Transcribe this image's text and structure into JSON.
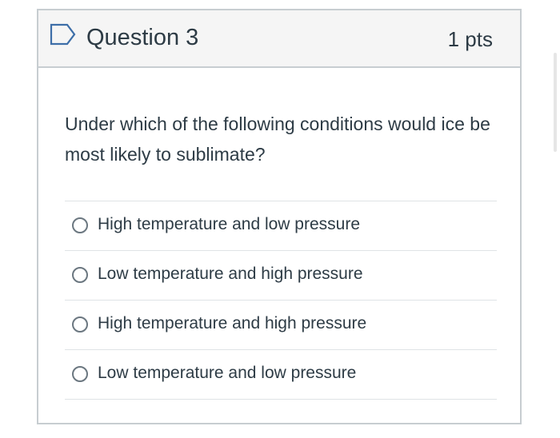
{
  "question": {
    "title": "Question 3",
    "points": "1 pts",
    "text": "Under which of the following conditions would ice be most likely to sublimate?",
    "answers": [
      {
        "label": "High temperature and low pressure",
        "selected": false
      },
      {
        "label": "Low temperature and high pressure",
        "selected": false
      },
      {
        "label": "High temperature and high pressure",
        "selected": false
      },
      {
        "label": "Low temperature and low pressure",
        "selected": false
      }
    ]
  },
  "icons": {
    "flag": "flag-outline-icon"
  },
  "colors": {
    "text": "#2d3b45",
    "border": "#c7cdd1",
    "header_bg": "#f5f5f5",
    "flag_blue": "#3d6ea8"
  }
}
